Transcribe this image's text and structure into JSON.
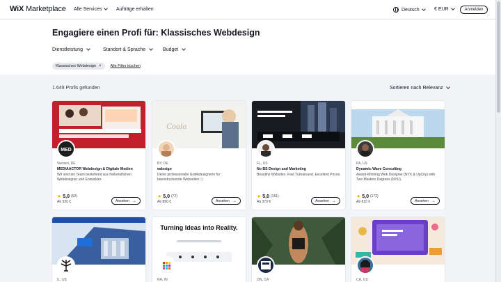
{
  "header": {
    "logo_wix": "WiX",
    "logo_marketplace": "Marketplace",
    "all_services": "Alle Services",
    "post_job": "Aufträge erhalten",
    "language": "Deutsch",
    "currency": "€ EUR",
    "login": "Anmelden"
  },
  "page": {
    "title": "Engagiere einen Profi für: Klassisches Webdesign",
    "filters": [
      "Dienstleistung",
      "Standort & Sprache",
      "Budget"
    ],
    "active_tag": "Klassisches Webdesign",
    "clear_filters": "Alle Filter löschen",
    "results_count": "1.649 Profis gefunden",
    "sort_label": "Sortieren nach Relevanz"
  },
  "cards": [
    {
      "location": "Viersen, DE",
      "name": "MEDIAACTOR Webdesign & Digitale Medien",
      "desc": "Wir sind ein Team bestehend aus freiberuflichen Webdesigner und Entwickler.",
      "rating": "5,0",
      "count": "(62)",
      "price": "Ab 320 €",
      "button": "Ansehen",
      "avatar_text": "MED"
    },
    {
      "location": "BY, DE",
      "name": "wdesign",
      "desc": "Deine professionelle Grafikdesignerin für beeindruckende Webseiten :)",
      "rating": "5,0",
      "count": "(72)",
      "price": "Ab 890 €",
      "button": "Ansehen"
    },
    {
      "location": "FL, US",
      "name": "No BS Design and Marketing",
      "desc": "Beautiful Websites. Fast Turnaround. Excellent Prices.",
      "rating": "5,0",
      "count": "(161)",
      "price": "Ab 370 €",
      "button": "Ansehen"
    },
    {
      "location": "PA, US",
      "name": "Dynamic Wave Consulting",
      "desc": "Award-Winning Web Designer (NYX & UpCity) with Two Masters Degrees (NYU).",
      "rating": "5,0",
      "count": "(172)",
      "price": "Ab 810 €",
      "button": "Ansehen"
    },
    {
      "location": "IL, US",
      "name": "",
      "desc": "",
      "rating": "",
      "count": "",
      "price": "",
      "button": ""
    },
    {
      "location": "RA, IN",
      "name": "",
      "desc": "",
      "rating": "",
      "count": "",
      "price": "",
      "button": "",
      "hero_text": "Turning Ideas into Reality."
    },
    {
      "location": "ON, CA",
      "name": "",
      "desc": "",
      "rating": "",
      "count": "",
      "price": "",
      "button": ""
    },
    {
      "location": "CA, US",
      "name": "",
      "desc": "",
      "rating": "",
      "count": "",
      "price": "",
      "button": ""
    }
  ],
  "colors": {
    "accent": "#116dff",
    "star": "#f5b300",
    "bg": "#f3f4f8"
  }
}
